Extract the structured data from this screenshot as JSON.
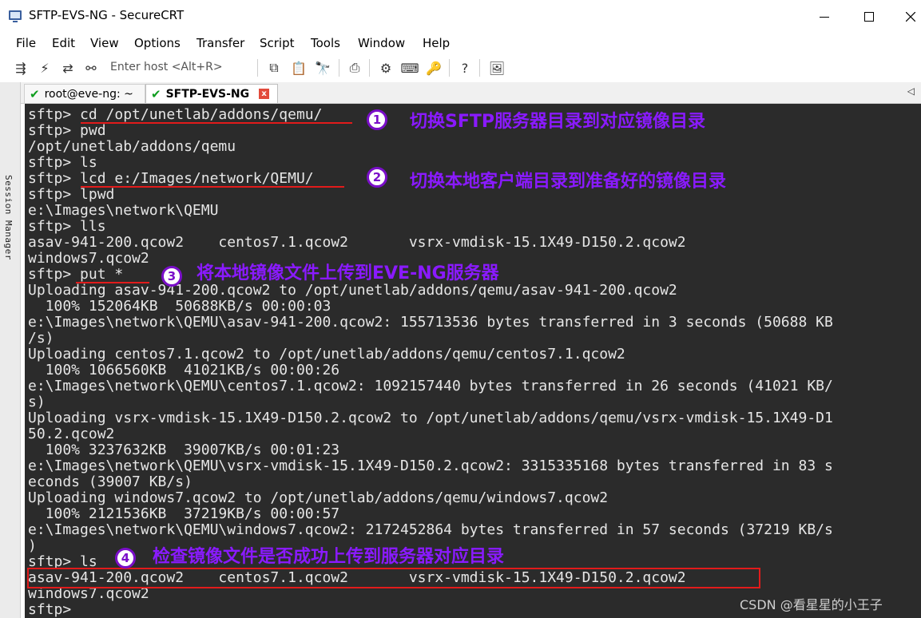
{
  "window": {
    "title": "SFTP-EVS-NG - SecureCRT"
  },
  "menu": [
    "File",
    "Edit",
    "View",
    "Options",
    "Transfer",
    "Script",
    "Tools",
    "Window",
    "Help"
  ],
  "toolbar": {
    "host_placeholder": "Enter host <Alt+R>"
  },
  "session_manager_label": "Session Manager",
  "tabs": [
    {
      "label": "root@eve-ng: ~",
      "status_icon": "check-icon"
    },
    {
      "label": "SFTP-EVS-NG",
      "status_icon": "check-icon",
      "active": true
    }
  ],
  "terminal": {
    "lines": [
      "sftp> cd /opt/unetlab/addons/qemu/",
      "sftp> pwd",
      "/opt/unetlab/addons/qemu",
      "sftp> ls",
      "sftp> lcd e:/Images/network/QEMU/",
      "sftp> lpwd",
      "e:\\Images\\network\\QEMU",
      "sftp> lls",
      "asav-941-200.qcow2    centos7.1.qcow2       vsrx-vmdisk-15.1X49-D150.2.qcow2",
      "windows7.qcow2",
      "sftp> put *",
      "Uploading asav-941-200.qcow2 to /opt/unetlab/addons/qemu/asav-941-200.qcow2",
      "  100% 152064KB  50688KB/s 00:00:03",
      "e:\\Images\\network\\QEMU\\asav-941-200.qcow2: 155713536 bytes transferred in 3 seconds (50688 KB",
      "/s)",
      "Uploading centos7.1.qcow2 to /opt/unetlab/addons/qemu/centos7.1.qcow2",
      "  100% 1066560KB  41021KB/s 00:00:26",
      "e:\\Images\\network\\QEMU\\centos7.1.qcow2: 1092157440 bytes transferred in 26 seconds (41021 KB/",
      "s)",
      "Uploading vsrx-vmdisk-15.1X49-D150.2.qcow2 to /opt/unetlab/addons/qemu/vsrx-vmdisk-15.1X49-D1",
      "50.2.qcow2",
      "  100% 3237632KB  39007KB/s 00:01:23",
      "e:\\Images\\network\\QEMU\\vsrx-vmdisk-15.1X49-D150.2.qcow2: 3315335168 bytes transferred in 83 s",
      "econds (39007 KB/s)",
      "Uploading windows7.qcow2 to /opt/unetlab/addons/qemu/windows7.qcow2",
      "  100% 2121536KB  37219KB/s 00:00:57",
      "e:\\Images\\network\\QEMU\\windows7.qcow2: 2172452864 bytes transferred in 57 seconds (37219 KB/s",
      ")",
      "sftp> ls",
      "asav-941-200.qcow2    centos7.1.qcow2       vsrx-vmdisk-15.1X49-D150.2.qcow2",
      "windows7.qcow2",
      "sftp> "
    ]
  },
  "annotations": [
    {
      "number": "1",
      "text": "切换SFTP服务器目录到对应镜像目录"
    },
    {
      "number": "2",
      "text": "切换本地客户端目录到准备好的镜像目录"
    },
    {
      "number": "3",
      "text": "将本地镜像文件上传到EVE-NG服务器"
    },
    {
      "number": "4",
      "text": "检查镜像文件是否成功上传到服务器对应目录"
    }
  ],
  "watermark": "CSDN @看星星的小王子",
  "colors": {
    "terminal_bg": "#2b2b2b",
    "terminal_fg": "#e6e6e6",
    "annotation_red": "#e21b1b",
    "annotation_purple": "#8a1aff"
  }
}
